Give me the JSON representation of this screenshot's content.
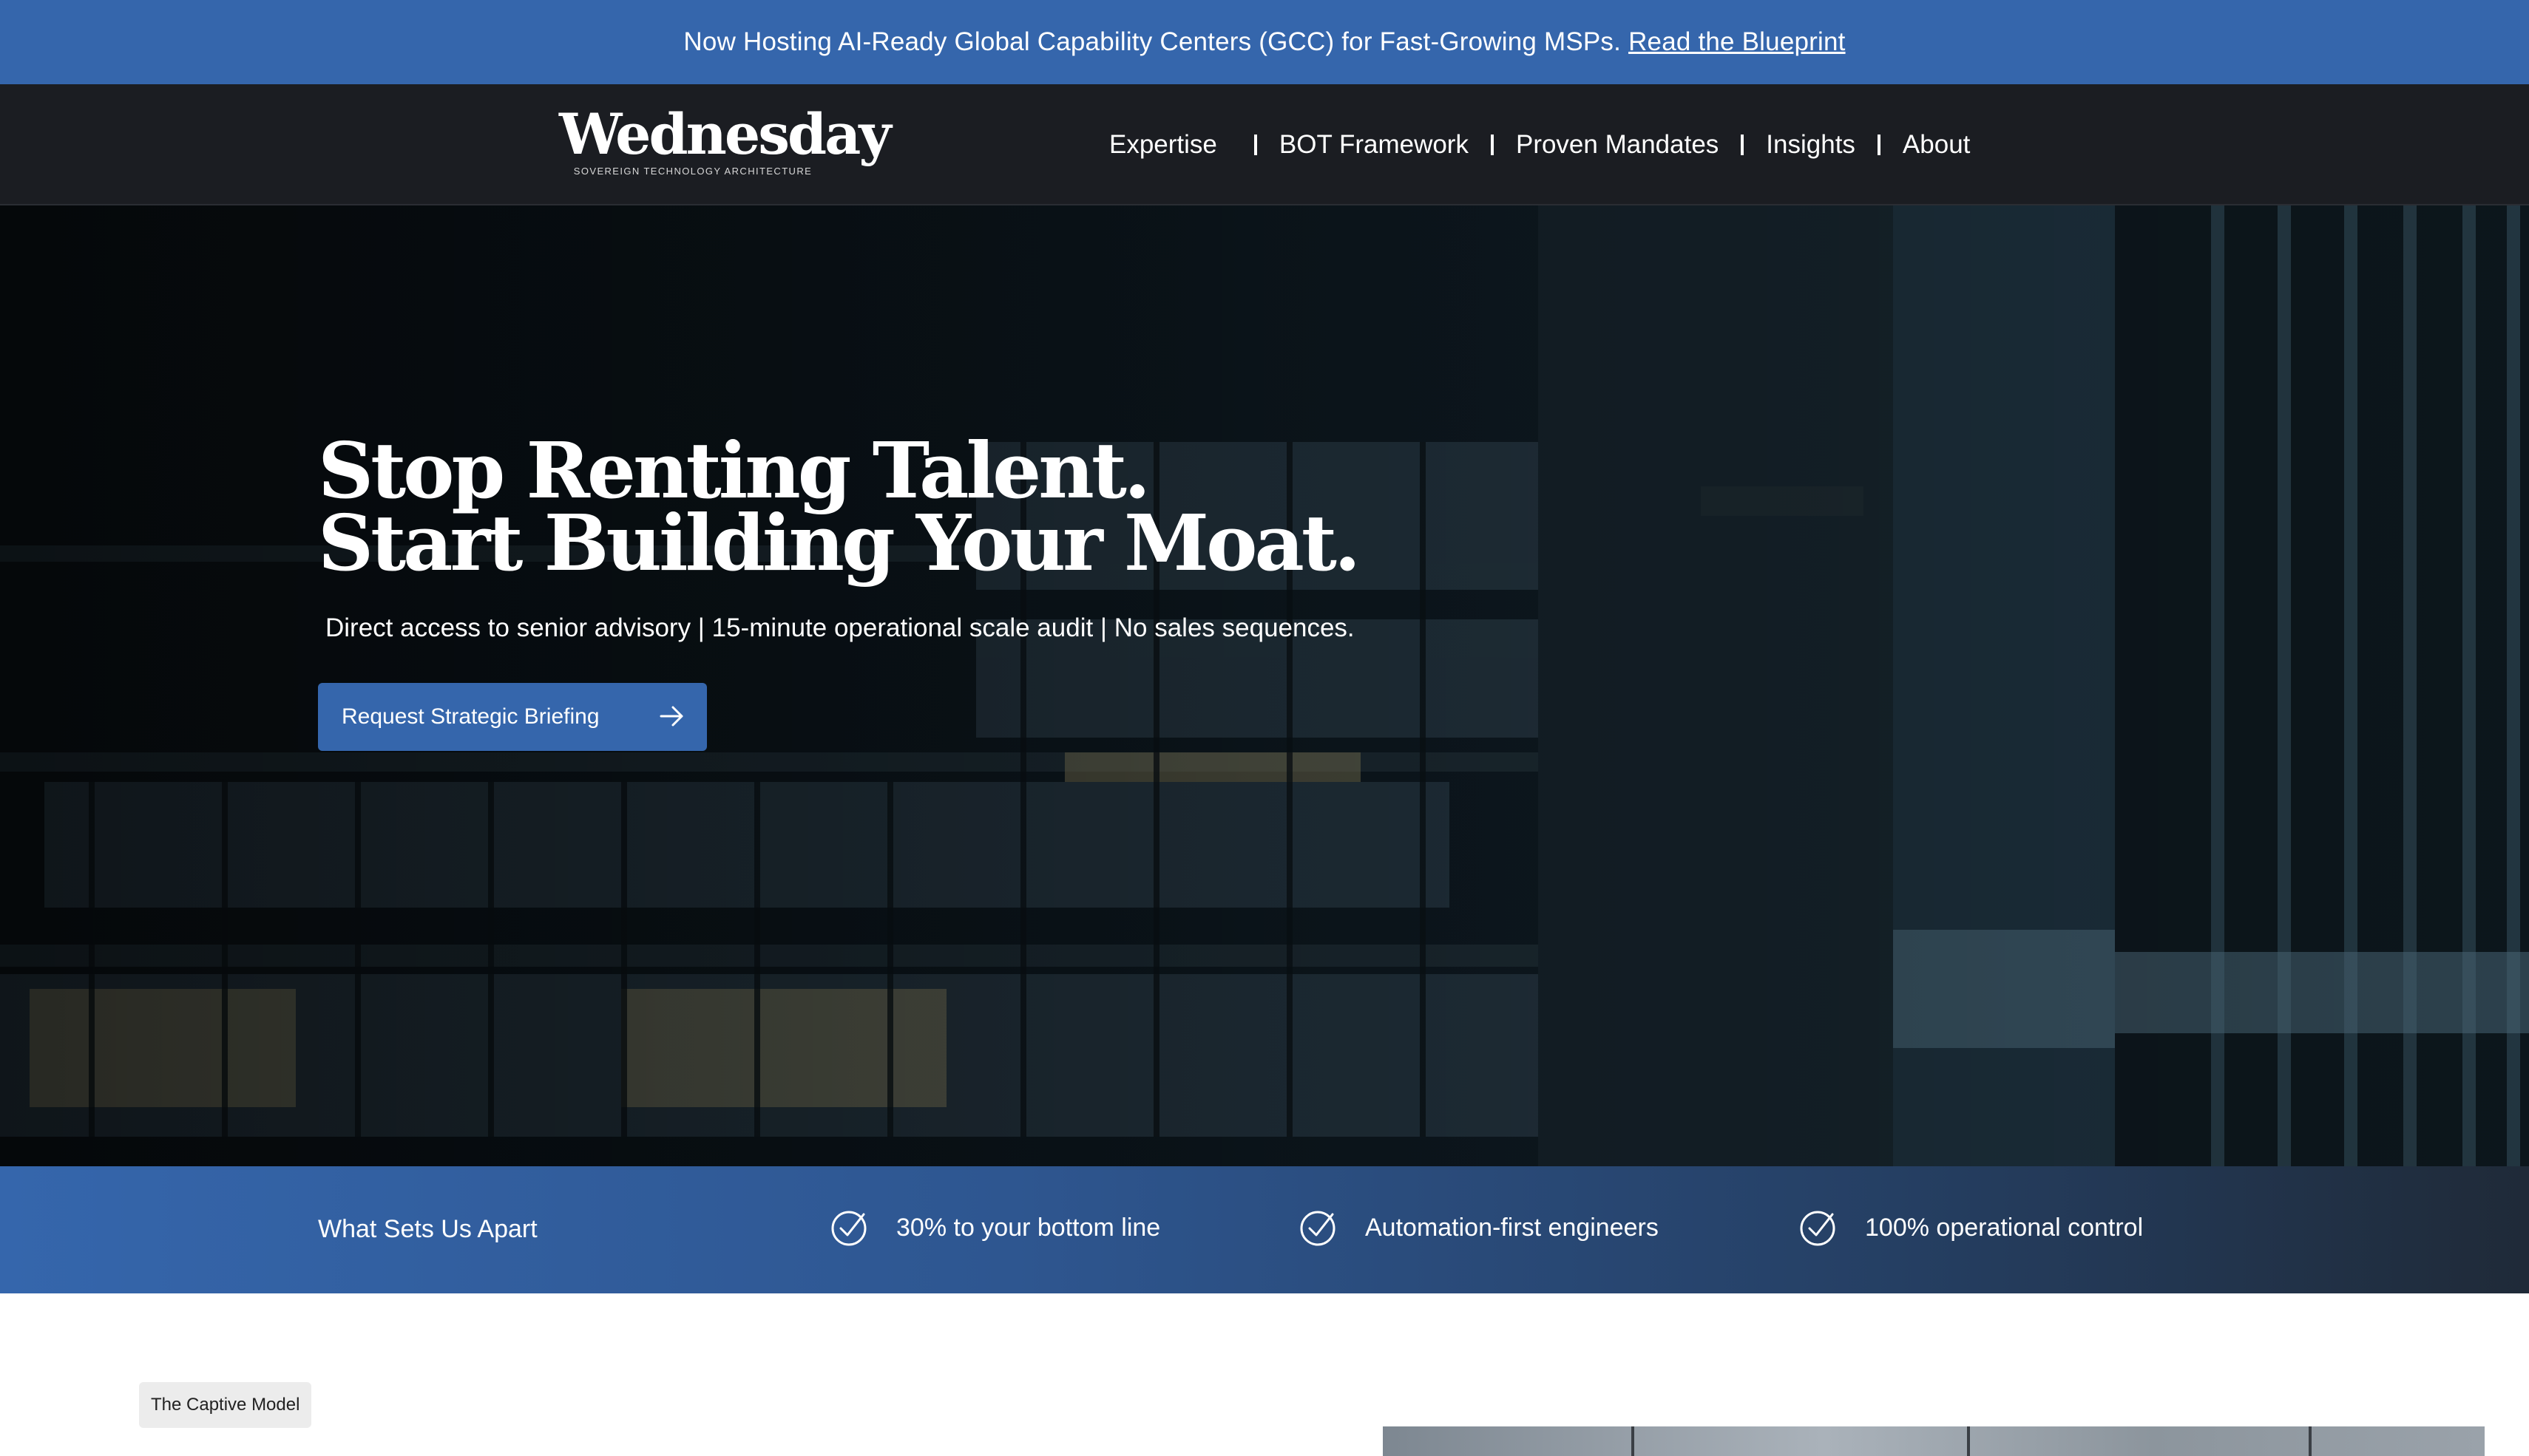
{
  "announcement": {
    "text": "Now Hosting AI-Ready Global Capability Centers (GCC) for Fast-Growing MSPs.",
    "link": "Read the Blueprint"
  },
  "header": {
    "logo": "Wednesday",
    "tagline": "SOVEREIGN TECHNOLOGY ARCHITECTURE",
    "nav": [
      "Expertise",
      "BOT Framework",
      "Proven Mandates",
      "Insights",
      "About"
    ]
  },
  "hero": {
    "title_line1": "Stop Renting Talent.",
    "title_line2": "Start Building Your Moat.",
    "subtitle": "Direct access to senior advisory | 15-minute operational scale audit | No sales sequences.",
    "cta": "Request Strategic Briefing"
  },
  "band": {
    "label": "What Sets Us Apart",
    "features": [
      "30% to your bottom line",
      "Automation-first engineers",
      "100% operational control"
    ]
  },
  "section": {
    "pill": "The Captive Model"
  },
  "colors": {
    "brand_blue": "#3566ac",
    "header_dark": "#1b1d22",
    "hero_dark": "#070c10"
  },
  "icons": [
    "arrow-right-icon",
    "check-circle-icon"
  ]
}
